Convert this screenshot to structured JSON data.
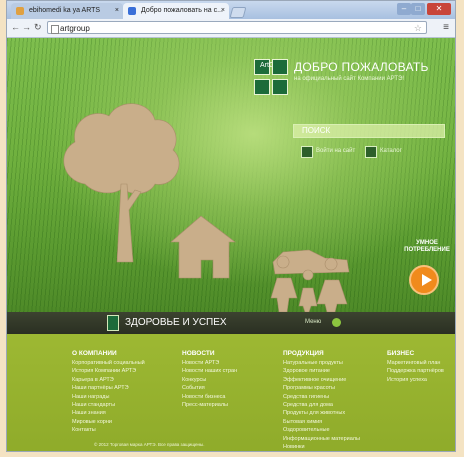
{
  "browser": {
    "tabs": [
      {
        "label": "ebihomedi ka ya ARTS"
      },
      {
        "label": "Добро пожаловать на с..."
      }
    ],
    "address": "artgroup",
    "window_buttons": {
      "min": "–",
      "max": "□",
      "close": "✕"
    }
  },
  "header": {
    "logo_text": "ArtGr",
    "welcome": "ДОБРО ПОЖАЛОВАТЬ",
    "subtitle": "на официальный сайт Компании АРТЭ!",
    "search_placeholder": "ПОИСК",
    "link_1": "Войти на сайт",
    "link_2": "Каталог"
  },
  "promo": {
    "label_line1": "УМНОЕ",
    "label_line2": "ПОТРЕБЛЕНИЕ"
  },
  "band": {
    "title": "ЗДОРОВЬЕ И УСПЕХ",
    "more": "Меню"
  },
  "footer": {
    "columns": [
      {
        "heading": "О КОМПАНИИ",
        "items": [
          "Корпоративный социальный",
          "История Компании АРТЭ",
          "Карьера в АРТЭ",
          "Наши партнёры АРТЭ",
          "Наши награды",
          "Наши стандарты",
          "Наши знания",
          "Мировые корни",
          "Контакты"
        ]
      },
      {
        "heading": "НОВОСТИ",
        "items": [
          "Новости АРТЭ",
          "Новости наших стран",
          "Конкурсы",
          "События",
          "Новости бизнеса",
          "Пресс-материалы"
        ]
      },
      {
        "heading": "ПРОДУКЦИЯ",
        "items": [
          "Натуральные продукты",
          "Здоровое питание",
          "Эффективное очищение",
          "Программы красоты",
          "Средства гигиены",
          "Средства для дома",
          "Продукты для животных",
          "Бытовая химия",
          "Оздоровительные",
          "Информационные материалы",
          "Новинки"
        ]
      },
      {
        "heading": "БИЗНЕС",
        "items": [
          "Маркетинговый план",
          "Поддержка партнёров",
          "История успеха"
        ]
      }
    ],
    "copyright": "© 2012 Торговая марка АРТЭ. Все права защищены."
  },
  "colors": {
    "grass": "#6fb03e",
    "footer": "#9db833",
    "band": "#2f3526",
    "accent": "#f08a1c",
    "logo": "#1c6b3a"
  }
}
